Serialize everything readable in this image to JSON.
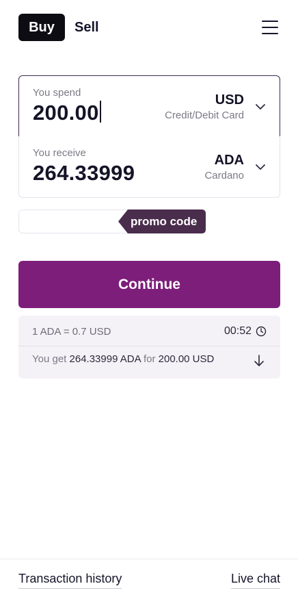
{
  "header": {
    "buy_label": "Buy",
    "sell_label": "Sell",
    "menu_icon": "hamburger-menu-icon"
  },
  "spend": {
    "label": "You spend",
    "amount": "200.00",
    "currency": "USD",
    "method": "Credit/Debit Card"
  },
  "receive": {
    "label": "You receive",
    "amount": "264.33999",
    "currency": "ADA",
    "currency_name": "Cardano"
  },
  "promo": {
    "value": "",
    "tag_label": "promo code"
  },
  "continue_label": "Continue",
  "rate": {
    "text": "1 ADA = 0.7 USD",
    "timer": "00:52",
    "you_get_prefix": "You get",
    "you_get_amount": "264.33999 ADA",
    "you_get_for": "for",
    "you_get_price": "200.00 USD"
  },
  "footer": {
    "history_label": "Transaction history",
    "chat_label": "Live chat"
  },
  "colors": {
    "accent": "#7d1e7a",
    "promo_tag": "#4a2d4d",
    "buy_tab": "#0d0c12",
    "info_bg": "#f5f2f7"
  }
}
